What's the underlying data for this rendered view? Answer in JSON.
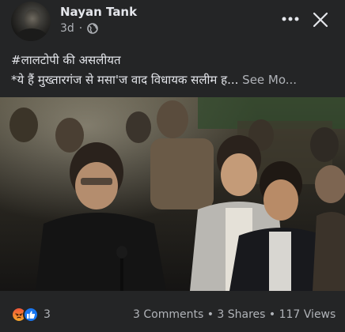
{
  "post": {
    "author": "Nayan Tank",
    "time": "3d",
    "privacy_icon": "globe-icon",
    "caption_line1": "#लालटोपी की असलीयत",
    "caption_line2": "*ये हैं मुख्तारगंज से मसा'ज वाद विधायक सलीम ह...",
    "see_more": "See Mo..."
  },
  "actions": {
    "more_icon": "more-options-icon",
    "close_icon": "close-icon"
  },
  "video": {
    "description_icon": "video-thumbnail"
  },
  "footer": {
    "reaction_icons": [
      "angry-reaction-icon",
      "like-reaction-icon"
    ],
    "reaction_count": "3",
    "stats": "3 Comments • 3 Shares • 117 Views"
  },
  "colors": {
    "background": "#242526",
    "primary_text": "#e4e6eb",
    "secondary_text": "#b0b3b8",
    "like_blue": "#1877f2",
    "angry_orange": "#f0563a"
  }
}
